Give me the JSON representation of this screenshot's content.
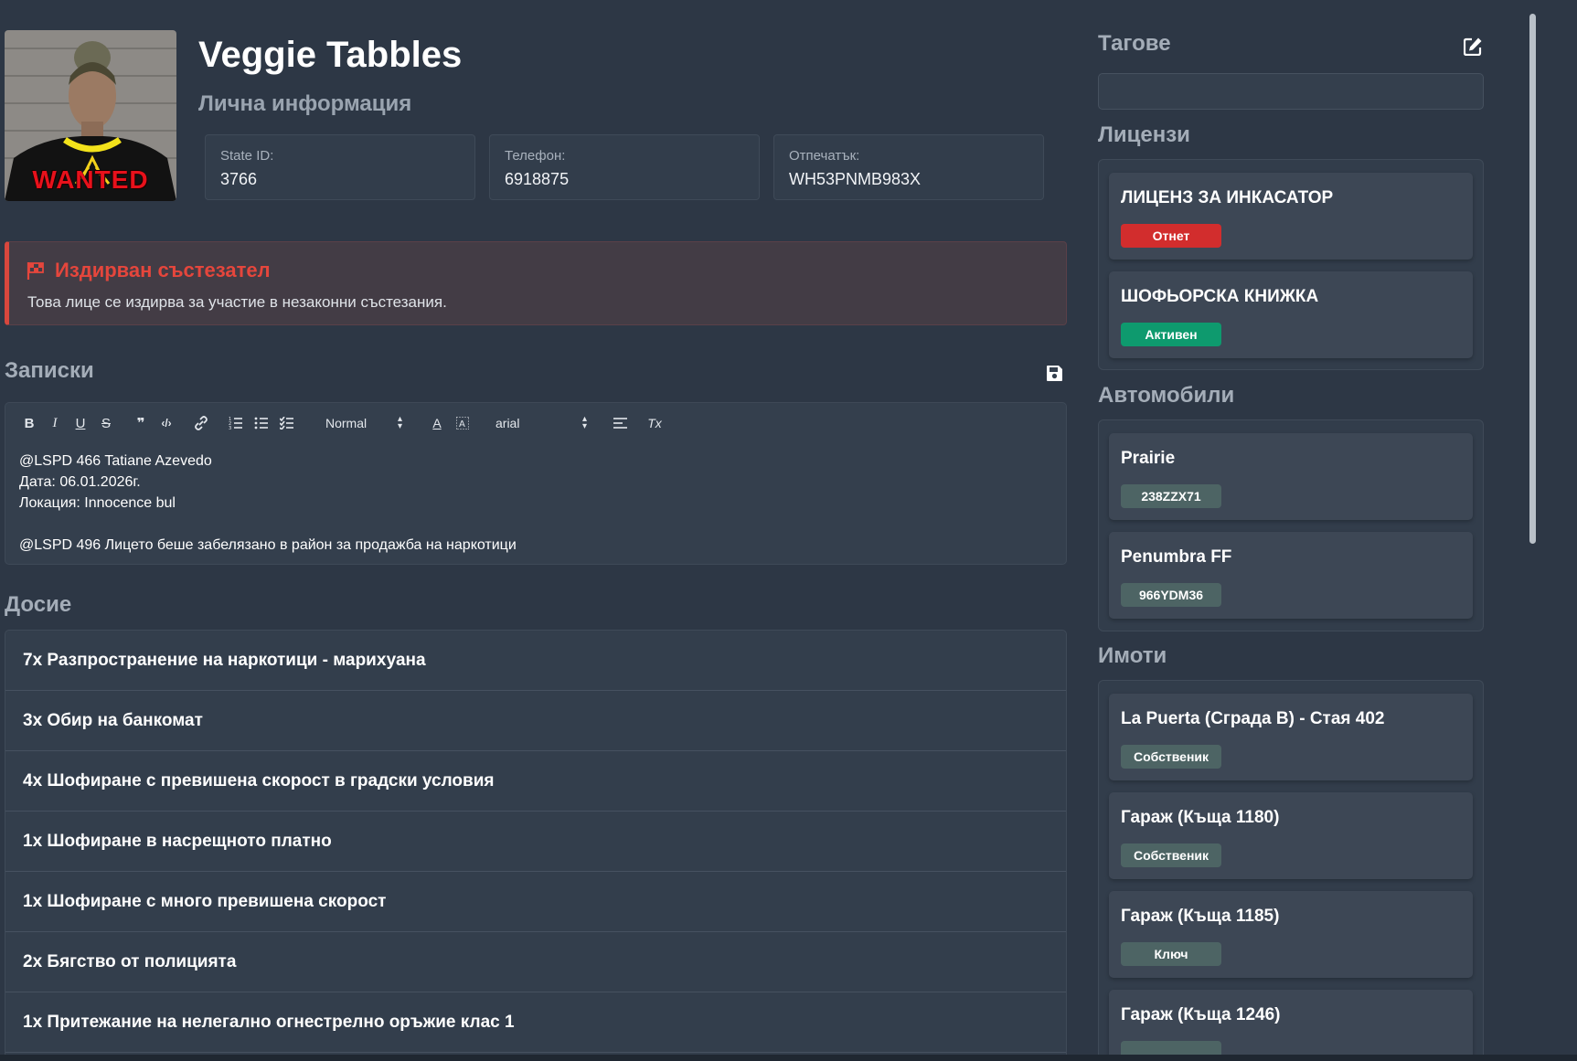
{
  "profile": {
    "name": "Veggie Tabbles",
    "subtitle": "Лична информация",
    "mugshot_caption": "WANTED",
    "state_id_label": "State ID:",
    "state_id": "3766",
    "phone_label": "Телефон:",
    "phone": "6918875",
    "fingerprint_label": "Отпечатък:",
    "fingerprint": "WH53PNMB983X"
  },
  "alert": {
    "title": "Издирван състезател",
    "text": "Това лице се издирва за участие в незаконни състезания.",
    "color": "#e5463c"
  },
  "notes": {
    "title": "Записки",
    "toolbar": {
      "bold": "B",
      "italic": "I",
      "underline": "U",
      "strike": "S",
      "quote": "❞",
      "code": "‹/›",
      "link": "🔗",
      "ordered_list": "☰",
      "bullet_list": "☰",
      "check_list": "☑",
      "size_value": "Normal",
      "font_value": "arial",
      "color": "A",
      "clean": "Tx"
    },
    "lines": [
      "@LSPD 466 Tatiane Azevedo",
      "Дата: 06.01.2026г.",
      "Локация: Innocence bul",
      "",
      "@LSPD 496 Лицето беше забелязано в район за продажба на наркотици"
    ]
  },
  "dossier": {
    "title": "Досие",
    "items": [
      "7x Разпространение на наркотици - марихуана",
      "3x Обир на банкомат",
      "4x Шофиране с превишена скорост в градски условия",
      "1x Шофиране в насрещното платно",
      "1x Шофиране с много превишена скорост",
      "2x Бягство от полицията",
      "1x Притежание на нелегално огнестрелно оръжие клас 1"
    ]
  },
  "tags": {
    "title": "Тагове",
    "value": ""
  },
  "licenses": {
    "title": "Лицензи",
    "items": [
      {
        "name": "ЛИЦЕНЗ ЗА ИНКАСАТОР",
        "status": "Отнет",
        "status_color": "#d22d2d"
      },
      {
        "name": "ШОФЬОРСКА КНИЖКА",
        "status": "Активен",
        "status_color": "#0e9a6e"
      }
    ]
  },
  "vehicles": {
    "title": "Автомобили",
    "items": [
      {
        "name": "Prairie",
        "plate": "238ZZX71"
      },
      {
        "name": "Penumbra FF",
        "plate": "966YDM36"
      }
    ]
  },
  "properties": {
    "title": "Имоти",
    "items": [
      {
        "name": "La Puerta (Сграда B) - Стая 402",
        "role": "Собственик"
      },
      {
        "name": "Гараж (Къща 1180)",
        "role": "Собственик"
      },
      {
        "name": "Гараж (Къща 1185)",
        "role": "Ключ"
      },
      {
        "name": "Гараж (Къща 1246)",
        "role": ""
      }
    ]
  },
  "colors": {
    "background": "#2d3745",
    "panel": "#323d4b",
    "card": "#3d4755",
    "badge_neutral": "#4d6464"
  }
}
